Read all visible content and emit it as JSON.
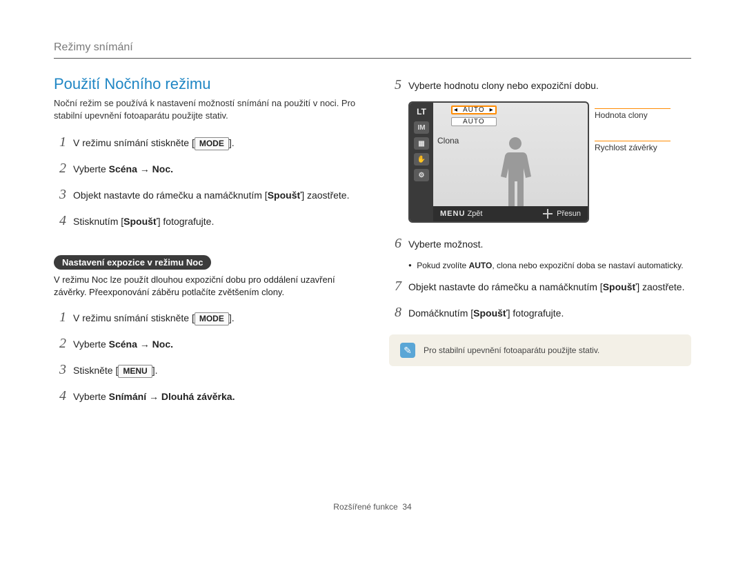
{
  "breadcrumb": "Režimy snímání",
  "heading": "Použití Nočního režimu",
  "intro": "Noční režim se používá k nastavení možností snímání na použití v noci. Pro stabilní upevnění fotoaparátu použijte stativ.",
  "steps_a": [
    {
      "n": "1",
      "pre": "V režimu snímání stiskněte ",
      "key": "MODE",
      "post": "."
    },
    {
      "n": "2",
      "pre": "Vyberte ",
      "bold": "Scéna → Noc.",
      "post": ""
    },
    {
      "n": "3",
      "pre": "Objekt nastavte do rámečku a namáčknutím [",
      "bold": "Spoušť",
      "post": "] zaostřete."
    },
    {
      "n": "4",
      "pre": "Stisknutím [",
      "bold": "Spoušť",
      "post": "] fotografujte."
    }
  ],
  "sub_heading": "Nastavení expozice v režimu Noc",
  "sub_desc": "V režimu Noc lze použít dlouhou expoziční dobu pro oddálení uzavření závěrky. Přeexponování záběru potlačíte zvětšením clony.",
  "steps_b": [
    {
      "n": "1",
      "pre": "V režimu snímání stiskněte ",
      "key": "MODE",
      "post": "."
    },
    {
      "n": "2",
      "pre": "Vyberte ",
      "bold": "Scéna → Noc.",
      "post": ""
    },
    {
      "n": "3",
      "pre": "Stiskněte ",
      "key": "MENU",
      "post": "."
    },
    {
      "n": "4",
      "pre": "Vyberte ",
      "bold": "Snímání → Dlouhá závěrka.",
      "post": ""
    }
  ],
  "steps_r": [
    {
      "n": "5",
      "pre": "Vyberte hodnotu clony nebo expoziční dobu.",
      "post": ""
    },
    {
      "n": "6",
      "pre": "Vyberte možnost.",
      "post": "",
      "bullet": {
        "pre": "Pokud zvolíte ",
        "bold": "AUTO",
        "post": ", clona nebo expoziční doba se nastaví automaticky."
      }
    },
    {
      "n": "7",
      "pre": "Objekt nastavte do rámečku a namáčknutím [",
      "bold": "Spoušť",
      "post": "] zaostřete."
    },
    {
      "n": "8",
      "pre": "Domáčknutím [",
      "bold": "Spoušť",
      "post": "] fotografujte."
    }
  ],
  "cam": {
    "lt": "LT",
    "auto1": "AUTO",
    "auto2": "AUTO",
    "clona": "Clona",
    "menu": "MENU",
    "zpet": "Zpět",
    "presun": "Přesun"
  },
  "callout1": "Hodnota clony",
  "callout2": "Rychlost závěrky",
  "note_text": "Pro stabilní upevnění fotoaparátu použijte stativ.",
  "footer_label": "Rozšířené funkce",
  "footer_page": "34"
}
